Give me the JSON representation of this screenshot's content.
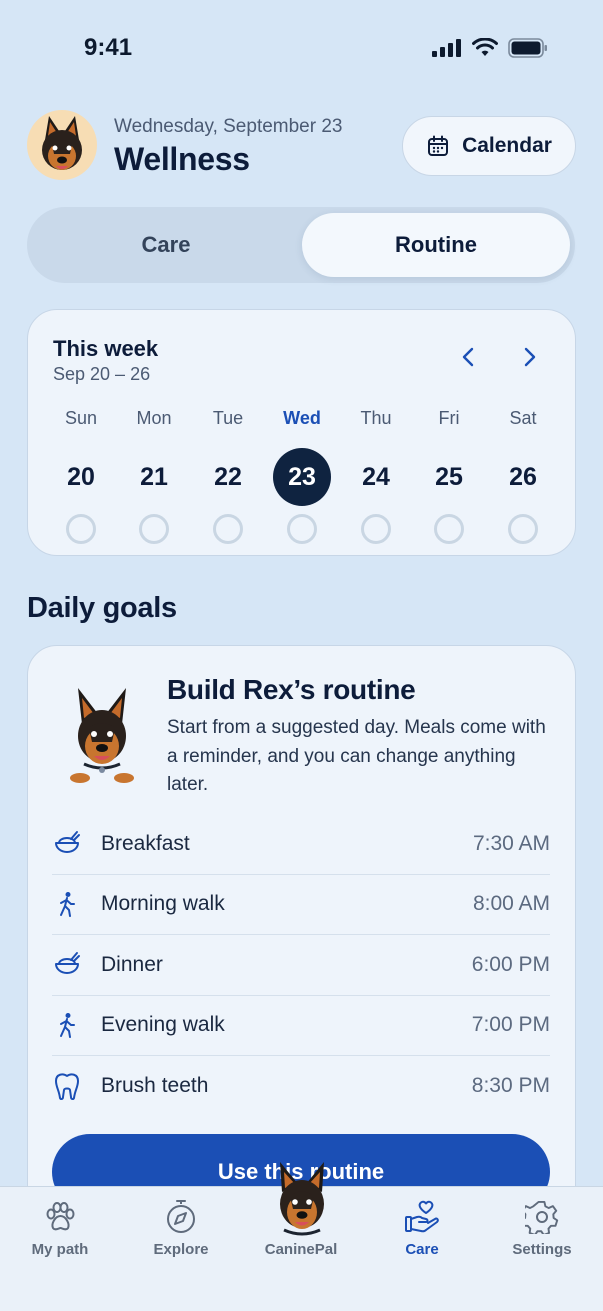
{
  "status": {
    "time": "9:41"
  },
  "header": {
    "date": "Wednesday, September 23",
    "title": "Wellness",
    "calendar_label": "Calendar"
  },
  "segment": {
    "care": "Care",
    "routine": "Routine",
    "selected": "Routine"
  },
  "week": {
    "title": "This week",
    "range": "Sep 20 – 26",
    "days": [
      {
        "name": "Sun",
        "num": "20"
      },
      {
        "name": "Mon",
        "num": "21"
      },
      {
        "name": "Tue",
        "num": "22"
      },
      {
        "name": "Wed",
        "num": "23"
      },
      {
        "name": "Thu",
        "num": "24"
      },
      {
        "name": "Fri",
        "num": "25"
      },
      {
        "name": "Sat",
        "num": "26"
      }
    ],
    "selected_day": "Wed"
  },
  "daily_goals": {
    "section_title": "Daily goals",
    "card_title": "Build Rex’s routine",
    "card_desc": "Start from a suggested day. Meals come with a reminder, and you can change anything later.",
    "items": [
      {
        "label": "Breakfast",
        "time": "7:30 AM",
        "icon": "meal-bowl-icon"
      },
      {
        "label": "Morning walk",
        "time": "8:00 AM",
        "icon": "walking-person-icon"
      },
      {
        "label": "Dinner",
        "time": "6:00 PM",
        "icon": "meal-bowl-icon"
      },
      {
        "label": "Evening walk",
        "time": "7:00 PM",
        "icon": "walking-person-icon"
      },
      {
        "label": "Brush teeth",
        "time": "8:30 PM",
        "icon": "tooth-icon"
      }
    ],
    "cta": "Use this routine"
  },
  "tabbar": {
    "items": [
      {
        "label": "My path",
        "icon": "paw-icon"
      },
      {
        "label": "Explore",
        "icon": "compass-icon"
      },
      {
        "label": "CaninePal",
        "icon": "dog-avatar-icon"
      },
      {
        "label": "Care",
        "icon": "heart-hand-icon"
      },
      {
        "label": "Settings",
        "icon": "gear-icon"
      }
    ],
    "active": "Care"
  },
  "colors": {
    "background": "#d6e6f6",
    "accent": "#1b4fb5",
    "navy": "#0f2340",
    "card": "#eef4fb"
  }
}
